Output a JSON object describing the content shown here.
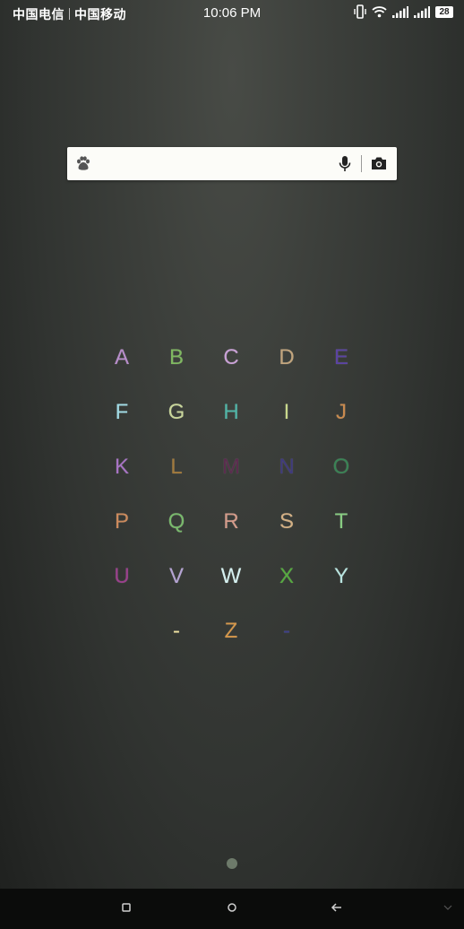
{
  "status_bar": {
    "carrier1": "中国电信",
    "carrier2": "中国移动",
    "time": "10:06 PM",
    "battery": "28",
    "icons": [
      "vibrate-icon",
      "wifi-icon",
      "signal-icon",
      "signal-icon",
      "battery-icon"
    ]
  },
  "search_widget": {
    "placeholder": "",
    "icons": [
      "baidu-paw-icon",
      "microphone-icon",
      "camera-icon"
    ]
  },
  "alphabet": [
    {
      "char": "A",
      "color": "#b88dcb"
    },
    {
      "char": "B",
      "color": "#7fb860"
    },
    {
      "char": "C",
      "color": "#c9a1d6"
    },
    {
      "char": "D",
      "color": "#c2a57d"
    },
    {
      "char": "E",
      "color": "#5b43a2"
    },
    {
      "char": "F",
      "color": "#a1dce6"
    },
    {
      "char": "G",
      "color": "#c9d69b"
    },
    {
      "char": "H",
      "color": "#4fb6a8"
    },
    {
      "char": "I",
      "color": "#c9d88c"
    },
    {
      "char": "J",
      "color": "#c98a4e"
    },
    {
      "char": "K",
      "color": "#a773c4"
    },
    {
      "char": "L",
      "color": "#a27a3c"
    },
    {
      "char": "M",
      "color": "#5b2c4e"
    },
    {
      "char": "N",
      "color": "#3f3a7c"
    },
    {
      "char": "O",
      "color": "#3a8355"
    },
    {
      "char": "P",
      "color": "#cc8a5c"
    },
    {
      "char": "Q",
      "color": "#79b96c"
    },
    {
      "char": "R",
      "color": "#d49b8a"
    },
    {
      "char": "S",
      "color": "#d4b084"
    },
    {
      "char": "T",
      "color": "#88cd82"
    },
    {
      "char": "U",
      "color": "#9a3f8c"
    },
    {
      "char": "V",
      "color": "#b5a4d4"
    },
    {
      "char": "W",
      "color": "#d6f1f1"
    },
    {
      "char": "X",
      "color": "#56ac3f"
    },
    {
      "char": "Y",
      "color": "#b9e5e0"
    },
    {
      "char": "-",
      "color": "#f0e3a0"
    },
    {
      "char": "Z",
      "color": "#d6974a"
    },
    {
      "char": "-",
      "color": "#3d3f8a"
    }
  ],
  "home": {
    "page_indicator": {
      "current": 1,
      "total": 1
    }
  },
  "nav_bar": {
    "buttons": [
      "recents-icon",
      "home-icon",
      "back-icon",
      "chevron-down-icon"
    ]
  }
}
